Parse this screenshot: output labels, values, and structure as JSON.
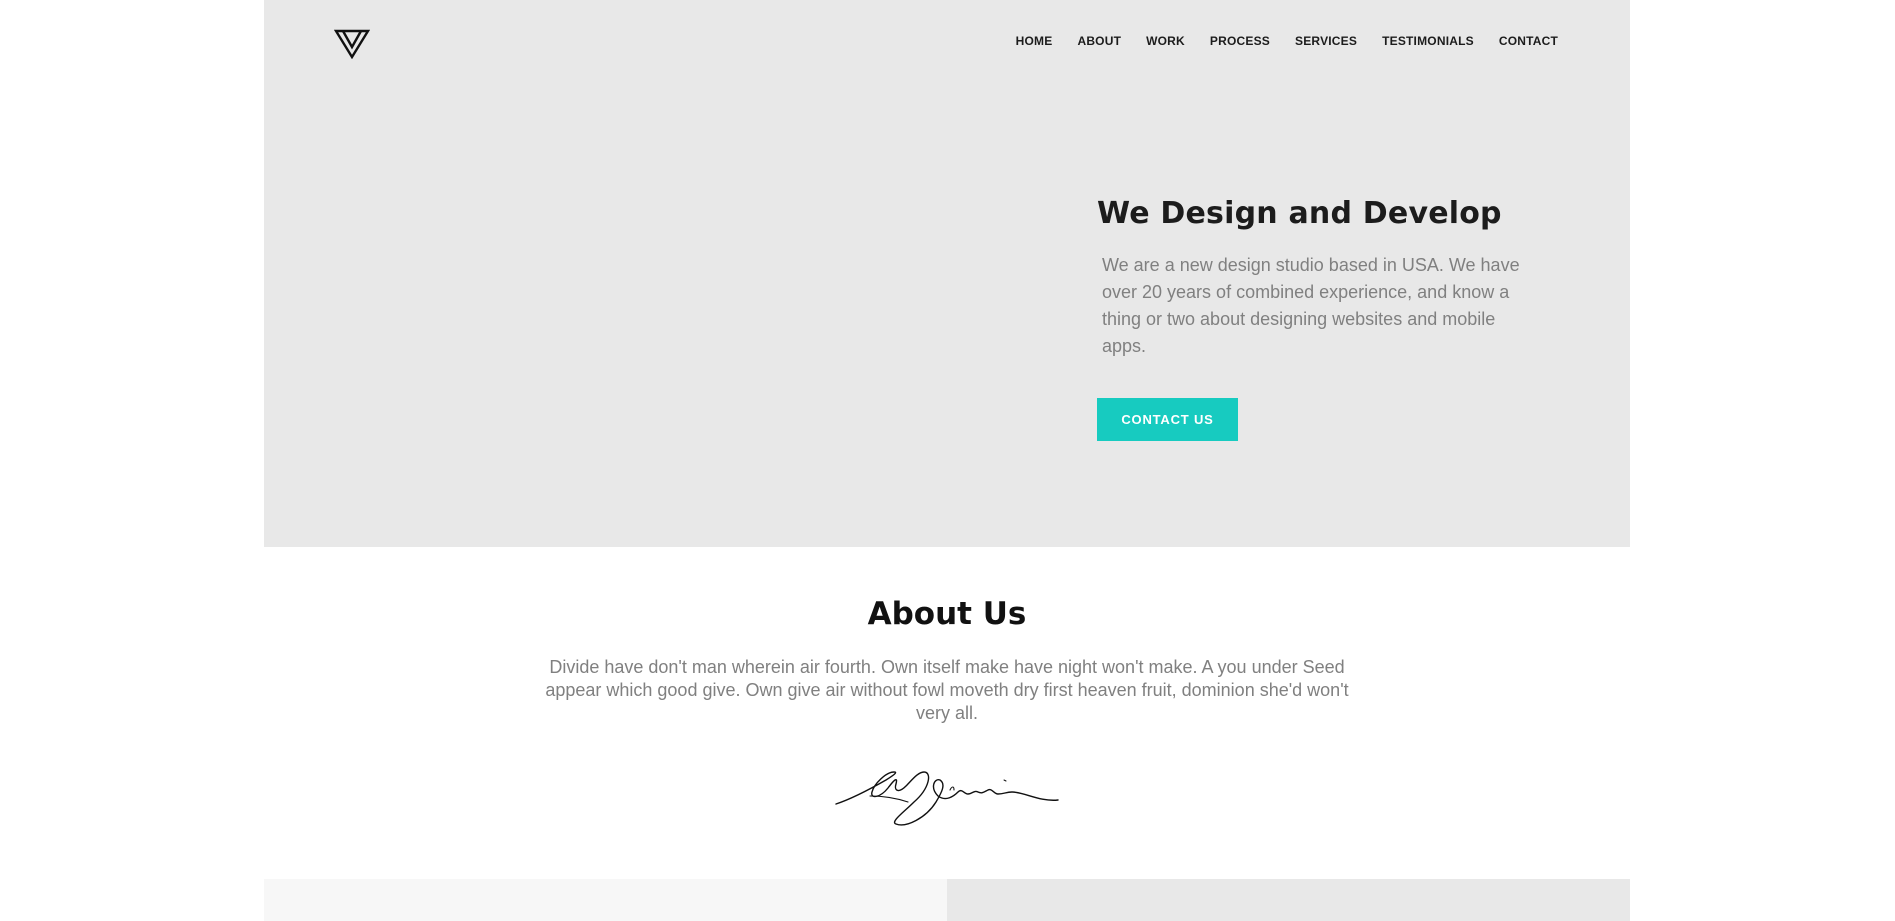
{
  "header": {
    "logo_icon": "triangle-logo-icon",
    "nav": [
      "HOME",
      "ABOUT",
      "WORK",
      "PROCESS",
      "SERVICES",
      "TESTIMONIALS",
      "CONTACT"
    ]
  },
  "hero": {
    "title": "We Design and Develop",
    "text": "We are a new design studio based in USA. We have over 20 years of combined experience, and know a thing or two about designing websites and mobile apps.",
    "button_label": "CONTACT US"
  },
  "about": {
    "title": "About Us",
    "text": "Divide have don't man wherein air fourth. Own itself make have night won't make. A you under Seed appear which good give. Own give air without fowl moveth dry first heaven fruit, dominion she'd won't very all."
  },
  "colors": {
    "accent": "#17cbc0",
    "hero_background": "#e8e8e8",
    "heading": "#1c1c1c",
    "body_text": "#808080"
  }
}
